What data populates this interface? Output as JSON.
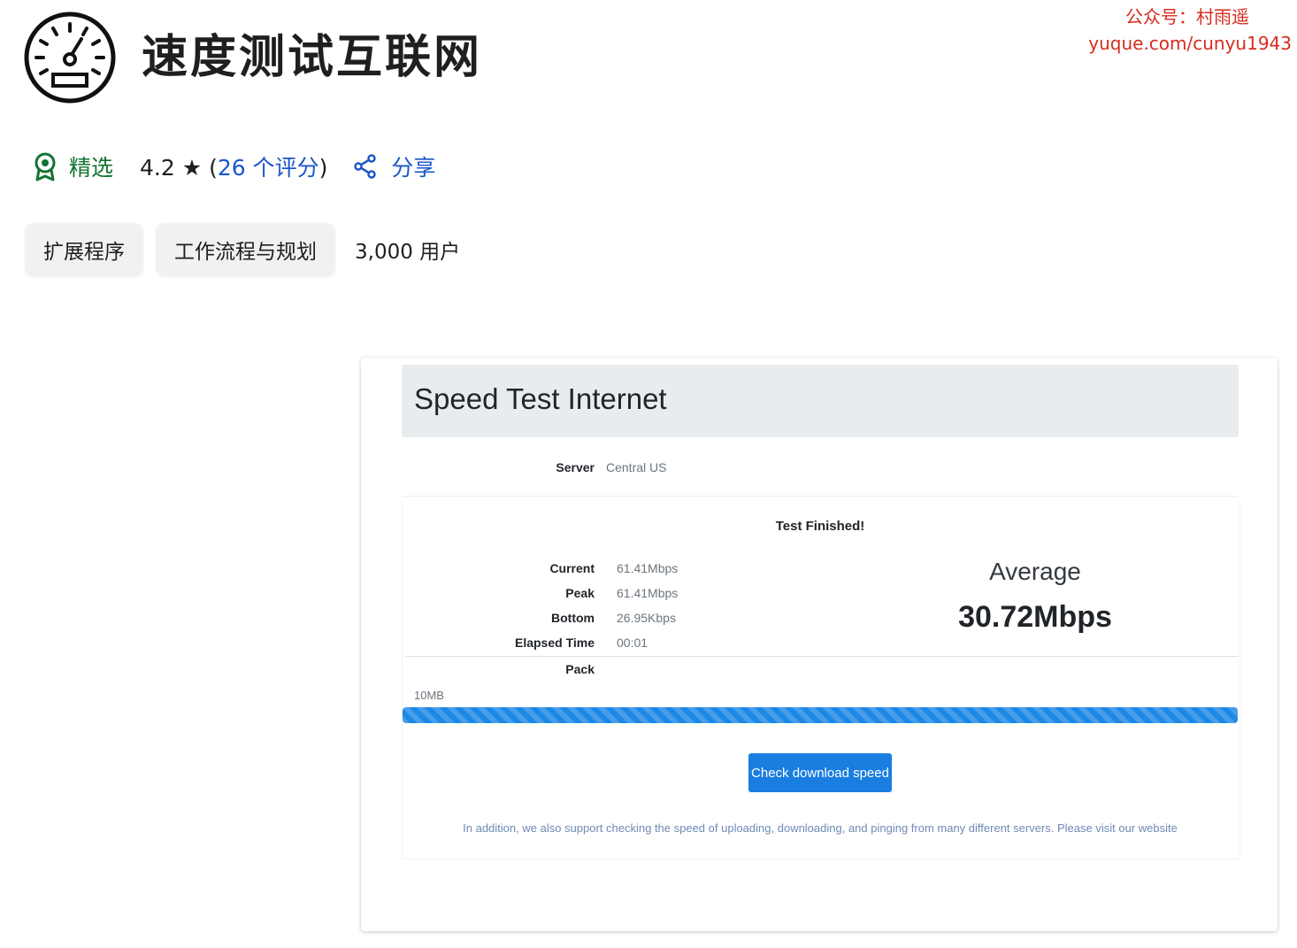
{
  "extension": {
    "title": "速度测试互联网",
    "icon": "speedometer-icon"
  },
  "watermark": {
    "line1": "公众号：村雨遥",
    "line2": "yuque.com/cunyu1943"
  },
  "meta": {
    "featured_label": "精选",
    "rating": "4.2",
    "star": "★",
    "reviews_open": "(",
    "reviews_text": "26 个评分",
    "reviews_close": ")",
    "share_label": "分享"
  },
  "chips": [
    "扩展程序",
    "工作流程与规划"
  ],
  "users": "3,000 用户",
  "colors": {
    "featured_green": "#137333",
    "link_blue": "#1a56c9",
    "watermark_red": "#d62c1f",
    "progress_blue": "#1e88e5",
    "button_blue": "#1a7ee0"
  },
  "screenshot": {
    "app_title": "Speed Test Internet",
    "server_label": "Server",
    "server_value": "Central US",
    "status": "Test Finished!",
    "stats": [
      {
        "label": "Current",
        "value": "61.41Mbps"
      },
      {
        "label": "Peak",
        "value": "61.41Mbps"
      },
      {
        "label": "Bottom",
        "value": "26.95Kbps"
      },
      {
        "label": "Elapsed Time",
        "value": "00:01"
      }
    ],
    "pack_label": "Pack",
    "average_label": "Average",
    "average_value": "30.72Mbps",
    "size_label": "10MB",
    "progress": 1.0,
    "button_label": "Check download speed",
    "footer_note": "In addition, we also support checking the speed of uploading, downloading, and pinging from many different servers. Please visit our website"
  }
}
